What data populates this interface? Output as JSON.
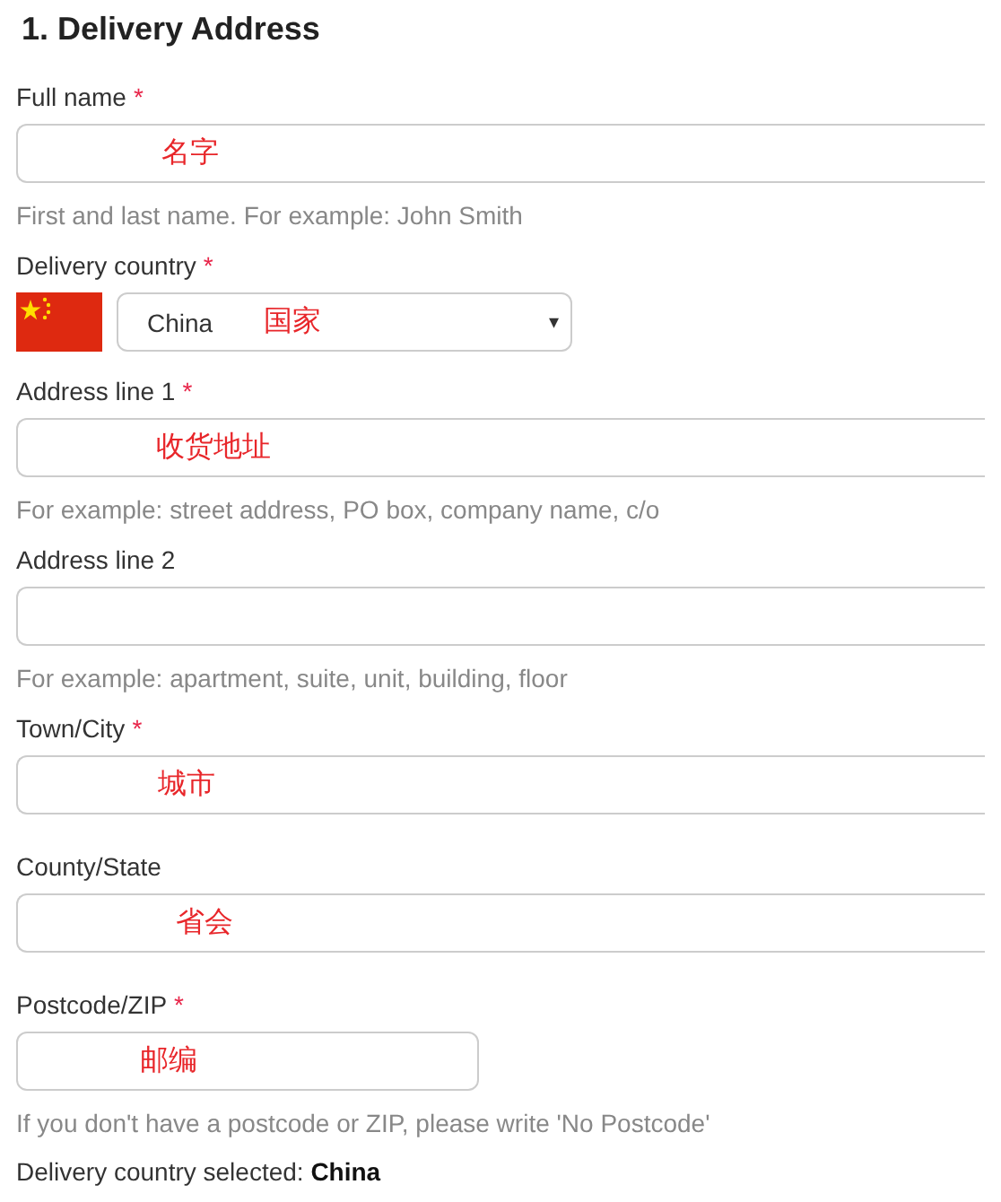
{
  "section_title": "1. Delivery Address",
  "fields": [
    {
      "kind": "text",
      "label": "Full name",
      "required": true,
      "annotation": "名字",
      "hint": "First and last name. For example: John Smith"
    },
    {
      "kind": "select",
      "label": "Delivery country",
      "required": true,
      "value": "China",
      "annotation": "国家"
    },
    {
      "kind": "text",
      "label": "Address line 1",
      "required": true,
      "annotation": "收货地址",
      "hint": "For example: street address, PO box, company name, c/o"
    },
    {
      "kind": "text",
      "label": "Address line 2",
      "required": false,
      "hint": "For example: apartment, suite, unit, building, floor"
    },
    {
      "kind": "text",
      "label": "Town/City",
      "required": true,
      "annotation": "城市"
    },
    {
      "kind": "text",
      "label": "County/State",
      "required": false,
      "annotation": "省会"
    },
    {
      "kind": "short",
      "label": "Postcode/ZIP",
      "required": true,
      "annotation": "邮编",
      "hint": "If you don't have a postcode or ZIP, please write 'No Postcode'"
    }
  ],
  "required_mark": "*",
  "dropdown_caret": "▾",
  "summary": "Delivery country selected: **China**"
}
